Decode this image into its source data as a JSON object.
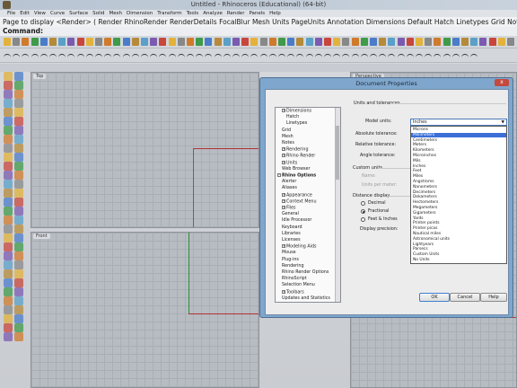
{
  "window": {
    "title": "Untitled - Rhinoceros (Educational) (64-bit)"
  },
  "menu": [
    "File",
    "Edit",
    "View",
    "Curve",
    "Surface",
    "Solid",
    "Mesh",
    "Dimension",
    "Transform",
    "Tools",
    "Analyze",
    "Render",
    "Panels",
    "Help"
  ],
  "command_history": "Page to display <Render> ( Render RhinoRender RenderDetails FocalBlur Mesh Units PageUnits Annotation Dimensions Default Hatch Linetypes Grid Notes WebBrowser Render",
  "command_prompt": "Command:",
  "viewports": {
    "top": "Top",
    "front": "Front",
    "right": "Perspective"
  },
  "dialog": {
    "title": "Document Properties",
    "close": "x",
    "tree": [
      {
        "label": "Dimensions",
        "depth": 1,
        "exp": "+"
      },
      {
        "label": "Hatch",
        "depth": 2,
        "exp": ""
      },
      {
        "label": "Linetypes",
        "depth": 2,
        "exp": ""
      },
      {
        "label": "Grid",
        "depth": 1,
        "exp": ""
      },
      {
        "label": "Mesh",
        "depth": 1,
        "exp": ""
      },
      {
        "label": "Notes",
        "depth": 1,
        "exp": ""
      },
      {
        "label": "Rendering",
        "depth": 1,
        "exp": "+"
      },
      {
        "label": "Rhino Render",
        "depth": 1,
        "exp": "+"
      },
      {
        "label": "Units",
        "depth": 1,
        "exp": "+"
      },
      {
        "label": "Web Browser",
        "depth": 1,
        "exp": ""
      },
      {
        "label": "Rhino Options",
        "depth": 0,
        "exp": "-",
        "bold": true
      },
      {
        "label": "Alerter",
        "depth": 1,
        "exp": ""
      },
      {
        "label": "Aliases",
        "depth": 1,
        "exp": ""
      },
      {
        "label": "Appearance",
        "depth": 1,
        "exp": "+"
      },
      {
        "label": "Context Menu",
        "depth": 1,
        "exp": "+"
      },
      {
        "label": "Files",
        "depth": 1,
        "exp": "+"
      },
      {
        "label": "General",
        "depth": 1,
        "exp": ""
      },
      {
        "label": "Idle Processor",
        "depth": 1,
        "exp": ""
      },
      {
        "label": "Keyboard",
        "depth": 1,
        "exp": ""
      },
      {
        "label": "Libraries",
        "depth": 1,
        "exp": ""
      },
      {
        "label": "Licenses",
        "depth": 1,
        "exp": ""
      },
      {
        "label": "Modeling Aids",
        "depth": 1,
        "exp": "+"
      },
      {
        "label": "Mouse",
        "depth": 1,
        "exp": ""
      },
      {
        "label": "Plug-ins",
        "depth": 1,
        "exp": ""
      },
      {
        "label": "Rendering",
        "depth": 1,
        "exp": ""
      },
      {
        "label": "Rhino Render Options",
        "depth": 1,
        "exp": ""
      },
      {
        "label": "RhinoScript",
        "depth": 1,
        "exp": ""
      },
      {
        "label": "Selection Menu",
        "depth": 1,
        "exp": ""
      },
      {
        "label": "Toolbars",
        "depth": 1,
        "exp": "+"
      },
      {
        "label": "Updates and Statistics",
        "depth": 1,
        "exp": ""
      }
    ],
    "units_section": "Units and tolerances",
    "model_units_label": "Model units:",
    "model_units_value": "Inches",
    "absolute_tolerance_label": "Absolute tolerance:",
    "relative_tolerance_label": "Relative tolerance:",
    "angle_tolerance_label": "Angle tolerance:",
    "custom_units_section": "Custom units",
    "name_label": "Name:",
    "units_per_meter_label": "Units per meter:",
    "distance_display_section": "Distance display",
    "radio_decimal": "Decimal",
    "radio_fractional": "Fractional",
    "radio_feet_inches": "Feet & Inches",
    "selected_radio": "Fractional",
    "display_precision_label": "Display precision:",
    "unit_options": [
      "Microns",
      "Millimeters",
      "Centimeters",
      "Meters",
      "Kilometers",
      "Microinches",
      "Mils",
      "Inches",
      "Feet",
      "Miles",
      "Angstroms",
      "Nanometers",
      "Decimeters",
      "Dekameters",
      "Hectometers",
      "Megameters",
      "Gigameters",
      "Yards",
      "Printer points",
      "Printer picas",
      "Nautical miles",
      "Astronomical units",
      "Lightyears",
      "Parsecs",
      "Custom Units",
      "No Units"
    ],
    "highlighted_option": "Millimeters",
    "buttons": {
      "ok": "OK",
      "cancel": "Cancel",
      "help": "Help"
    }
  }
}
